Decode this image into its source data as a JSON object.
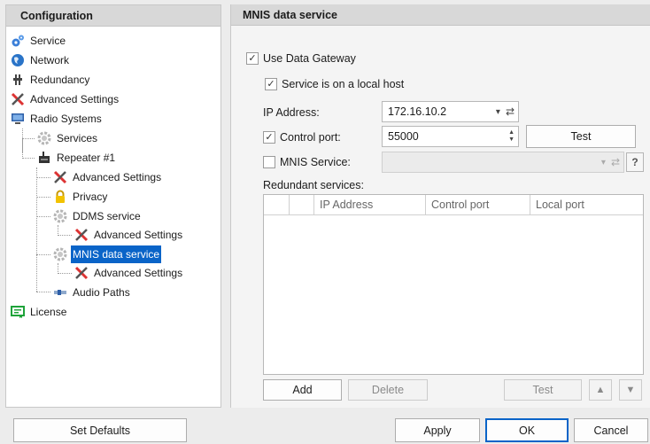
{
  "left_panel": {
    "title": "Configuration",
    "tree": [
      {
        "label": "Service",
        "icon": "gears-icon"
      },
      {
        "label": "Network",
        "icon": "globe-icon"
      },
      {
        "label": "Redundancy",
        "icon": "redundancy-icon"
      },
      {
        "label": "Advanced Settings",
        "icon": "tools-icon"
      },
      {
        "label": "Radio Systems",
        "icon": "computer-icon"
      },
      {
        "label": "Services",
        "icon": "gear-icon"
      },
      {
        "label": "Repeater #1",
        "icon": "repeater-icon"
      },
      {
        "label": "Advanced Settings",
        "icon": "tools-icon"
      },
      {
        "label": "Privacy",
        "icon": "lock-icon"
      },
      {
        "label": "DDMS service",
        "icon": "gear-icon"
      },
      {
        "label": "Advanced Settings",
        "icon": "tools-icon"
      },
      {
        "label": "MNIS data service",
        "icon": "gear-icon",
        "selected": true
      },
      {
        "label": "Advanced Settings",
        "icon": "tools-icon"
      },
      {
        "label": "Audio Paths",
        "icon": "audio-path-icon"
      },
      {
        "label": "License",
        "icon": "license-icon"
      }
    ]
  },
  "right_panel": {
    "title": "MNIS data service",
    "use_data_gateway": {
      "label": "Use Data Gateway",
      "checked": true
    },
    "local_host": {
      "label": "Service is on a local host",
      "checked": true
    },
    "ip_address": {
      "label": "IP Address:",
      "value": "172.16.10.2"
    },
    "control_port": {
      "label": "Control port:",
      "checked": true,
      "value": "55000",
      "test_label": "Test"
    },
    "mnis_service": {
      "label": "MNIS Service:",
      "checked": false,
      "value": "",
      "help_label": "?"
    },
    "redundant": {
      "label": "Redundant services:",
      "columns": [
        "IP Address",
        "Control port",
        "Local port"
      ],
      "add_label": "Add",
      "delete_label": "Delete",
      "test_label": "Test",
      "up_label": "▲",
      "down_label": "▼"
    }
  },
  "bottom_bar": {
    "set_defaults_label": "Set Defaults",
    "apply_label": "Apply",
    "ok_label": "OK",
    "cancel_label": "Cancel"
  },
  "colors": {
    "selection": "#0a64c8",
    "header_bg": "#d8d8d8"
  }
}
